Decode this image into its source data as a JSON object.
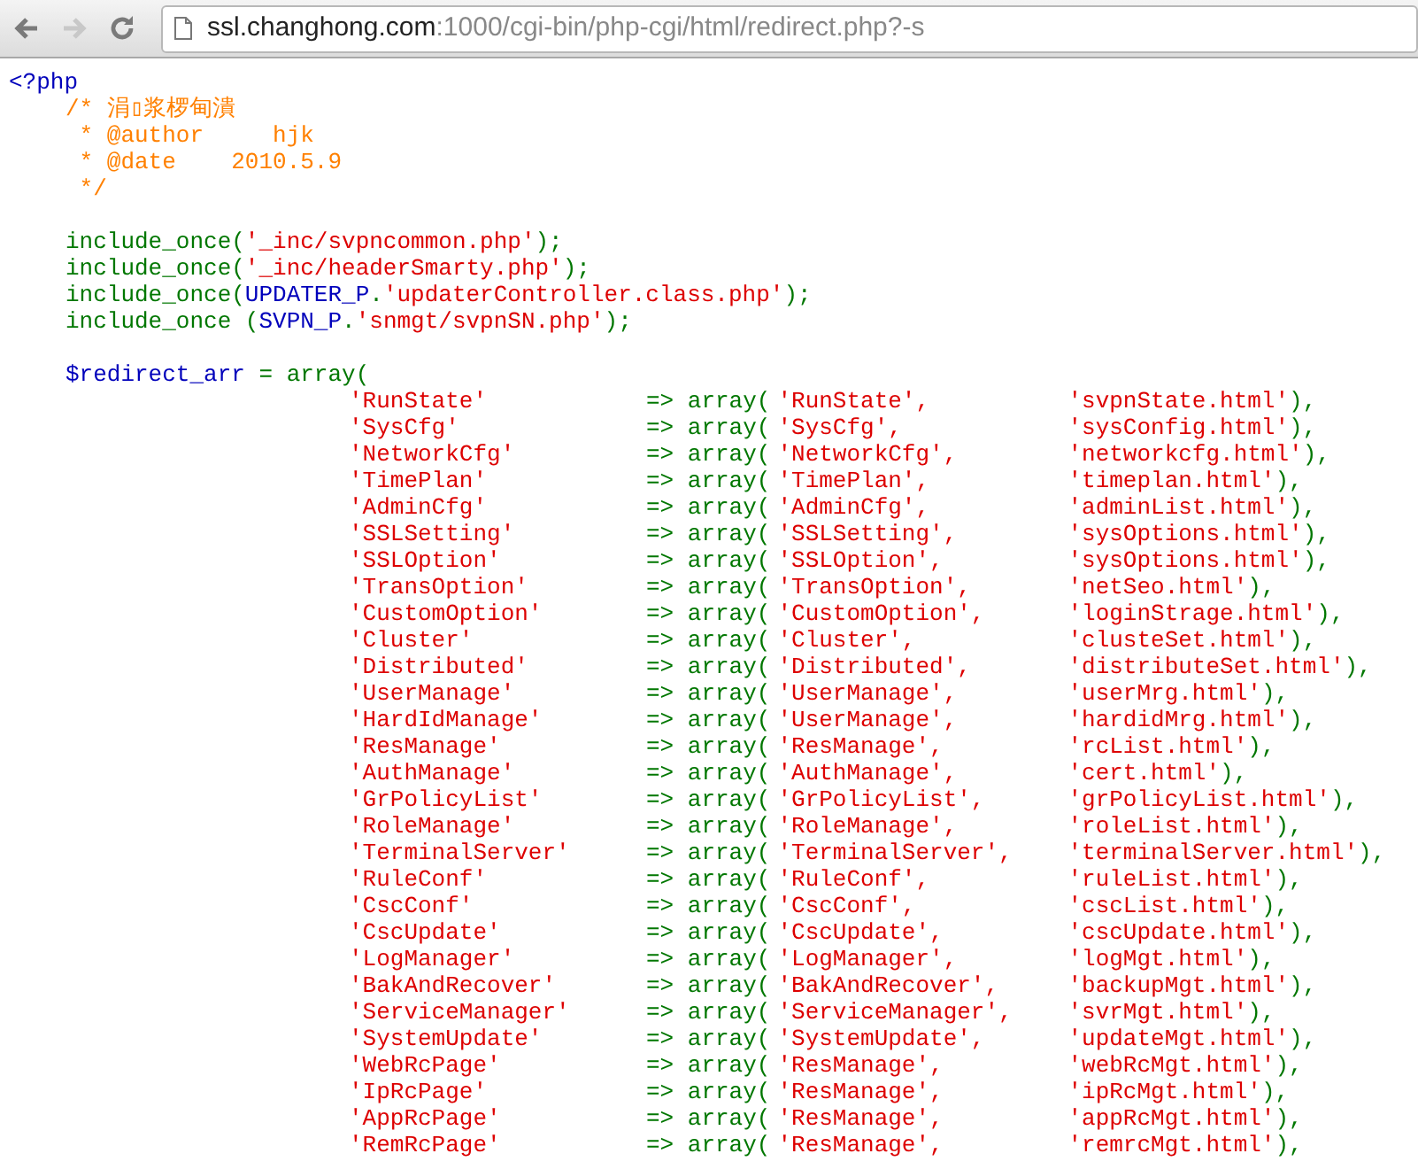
{
  "nav_buttons": [
    {
      "kind": "back",
      "disabled": false
    },
    {
      "kind": "forward",
      "disabled": true
    },
    {
      "kind": "reload",
      "disabled": false
    }
  ],
  "address_bar": {
    "host": "ssl.changhong.com",
    "path": ":1000/cgi-bin/php-cgi/html/redirect.php?-s"
  },
  "source": {
    "open_tag": "<?php",
    "comment_lines": [
      "/* 涓▯浆椤甸潰",
      " * @author     hjk",
      " * @date    2010.5.9",
      " */"
    ],
    "includes": [
      [
        {
          "kind": "keyword",
          "text": "include_once("
        },
        {
          "kind": "string",
          "text": "'_inc/svpncommon.php'"
        },
        {
          "kind": "keyword",
          "text": ");"
        }
      ],
      [
        {
          "kind": "keyword",
          "text": "include_once("
        },
        {
          "kind": "string",
          "text": "'_inc/headerSmarty.php'"
        },
        {
          "kind": "keyword",
          "text": ");"
        }
      ],
      [
        {
          "kind": "keyword",
          "text": "include_once("
        },
        {
          "kind": "default",
          "text": "UPDATER_P"
        },
        {
          "kind": "keyword",
          "text": "."
        },
        {
          "kind": "string",
          "text": "'updaterController.class.php'"
        },
        {
          "kind": "keyword",
          "text": ");"
        }
      ],
      [
        {
          "kind": "keyword",
          "text": "include_once ("
        },
        {
          "kind": "default",
          "text": "SVPN_P"
        },
        {
          "kind": "keyword",
          "text": "."
        },
        {
          "kind": "string",
          "text": "'snmgt/svpnSN.php'"
        },
        {
          "kind": "keyword",
          "text": ");"
        }
      ]
    ],
    "array_head": [
      {
        "kind": "default",
        "text": "$redirect_arr"
      },
      {
        "kind": "keyword",
        "text": " = array("
      }
    ],
    "entries": [
      {
        "key": "'RunState'",
        "arrow": "=> array(",
        "name": "'RunState',",
        "file": "'svpnState.html'",
        "close": "),"
      },
      {
        "key": "'SysCfg'",
        "arrow": "=> array(",
        "name": "'SysCfg',",
        "file": "'sysConfig.html'",
        "close": "),"
      },
      {
        "key": "'NetworkCfg'",
        "arrow": "=> array(",
        "name": "'NetworkCfg',",
        "file": "'networkcfg.html'",
        "close": "),"
      },
      {
        "key": "'TimePlan'",
        "arrow": "=> array(",
        "name": "'TimePlan',",
        "file": "'timeplan.html'",
        "close": "),"
      },
      {
        "key": "'AdminCfg'",
        "arrow": "=> array(",
        "name": "'AdminCfg',",
        "file": "'adminList.html'",
        "close": "),"
      },
      {
        "key": "'SSLSetting'",
        "arrow": "=> array(",
        "name": "'SSLSetting',",
        "file": "'sysOptions.html'",
        "close": "),"
      },
      {
        "key": "'SSLOption'",
        "arrow": "=> array(",
        "name": "'SSLOption',",
        "file": "'sysOptions.html'",
        "close": "),"
      },
      {
        "key": "'TransOption'",
        "arrow": "=> array(",
        "name": "'TransOption',",
        "file": "'netSeo.html'",
        "close": "),"
      },
      {
        "key": "'CustomOption'",
        "arrow": "=> array(",
        "name": "'CustomOption',",
        "file": "'loginStrage.html'",
        "close": "),"
      },
      {
        "key": "'Cluster'",
        "arrow": "=> array(",
        "name": "'Cluster',",
        "file": "'clusteSet.html'",
        "close": "),"
      },
      {
        "key": "'Distributed'",
        "arrow": "=> array(",
        "name": "'Distributed',",
        "file": "'distributeSet.html'",
        "close": "),"
      },
      {
        "key": "'UserManage'",
        "arrow": "=> array(",
        "name": "'UserManage',",
        "file": "'userMrg.html'",
        "close": "),"
      },
      {
        "key": "'HardIdManage'",
        "arrow": "=> array(",
        "name": "'UserManage',",
        "file": "'hardidMrg.html'",
        "close": "),"
      },
      {
        "key": "'ResManage'",
        "arrow": "=> array(",
        "name": "'ResManage',",
        "file": "'rcList.html'",
        "close": "),"
      },
      {
        "key": "'AuthManage'",
        "arrow": "=> array(",
        "name": "'AuthManage',",
        "file": "'cert.html'",
        "close": "),"
      },
      {
        "key": "'GrPolicyList'",
        "arrow": "=> array(",
        "name": "'GrPolicyList',",
        "file": "'grPolicyList.html'",
        "close": "),"
      },
      {
        "key": "'RoleManage'",
        "arrow": "=> array(",
        "name": "'RoleManage',",
        "file": "'roleList.html'",
        "close": "),"
      },
      {
        "key": "'TerminalServer'",
        "arrow": "=> array(",
        "name": "'TerminalServer',",
        "file": "'terminalServer.html'",
        "close": "),"
      },
      {
        "key": "'RuleConf'",
        "arrow": "=> array(",
        "name": "'RuleConf',",
        "file": "'ruleList.html'",
        "close": "),"
      },
      {
        "key": "'CscConf'",
        "arrow": "=> array(",
        "name": "'CscConf',",
        "file": "'cscList.html'",
        "close": "),"
      },
      {
        "key": "'CscUpdate'",
        "arrow": "=> array(",
        "name": "'CscUpdate',",
        "file": "'cscUpdate.html'",
        "close": "),"
      },
      {
        "key": "'LogManager'",
        "arrow": "=> array(",
        "name": "'LogManager',",
        "file": "'logMgt.html'",
        "close": "),"
      },
      {
        "key": "'BakAndRecover'",
        "arrow": "=> array(",
        "name": "'BakAndRecover',",
        "file": "'backupMgt.html'",
        "close": "),"
      },
      {
        "key": "'ServiceManager'",
        "arrow": "=> array(",
        "name": "'ServiceManager',",
        "file": "'svrMgt.html'",
        "close": "),"
      },
      {
        "key": "'SystemUpdate'",
        "arrow": "=> array(",
        "name": "'SystemUpdate',",
        "file": "'updateMgt.html'",
        "close": "),"
      },
      {
        "key": "'WebRcPage'",
        "arrow": "=> array(",
        "name": "'ResManage',",
        "file": "'webRcMgt.html'",
        "close": "),"
      },
      {
        "key": "'IpRcPage'",
        "arrow": "=> array(",
        "name": "'ResManage',",
        "file": "'ipRcMgt.html'",
        "close": "),"
      },
      {
        "key": "'AppRcPage'",
        "arrow": "=> array(",
        "name": "'ResManage',",
        "file": "'appRcMgt.html'",
        "close": "),"
      },
      {
        "key": "'RemRcPage'",
        "arrow": "=> array(",
        "name": "'ResManage',",
        "file": "'remrcMgt.html'",
        "close": "),"
      }
    ]
  }
}
